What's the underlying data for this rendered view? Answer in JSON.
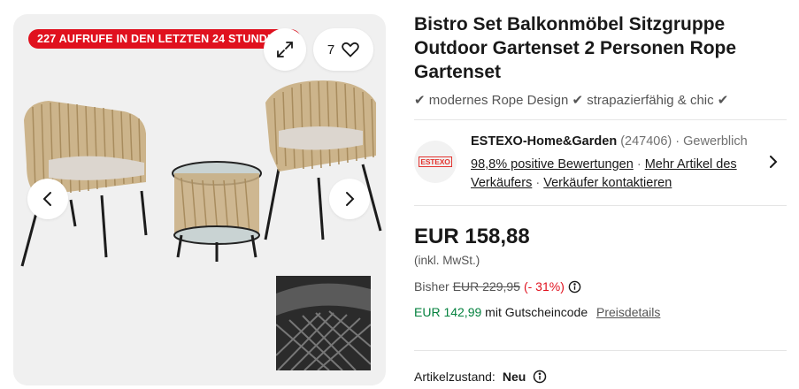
{
  "gallery": {
    "views_badge": "227 AUFRUFE IN DEN LETZTEN 24 STUNDEN",
    "watch_count": "7"
  },
  "product": {
    "title": "Bistro Set Balkonmöbel Sitzgruppe Outdoor Gartenset 2 Personen Rope Gartenset",
    "subtitle": "✔ modernes Rope Design ✔ strapazierfähig & chic ✔"
  },
  "seller": {
    "logo_text": "ESTEXO",
    "name": "ESTEXO-Home&Garden",
    "feedback_count": "(247406)",
    "type": "· Gewerblich",
    "positive": "98,8% positive Bewertungen",
    "more_items": "Mehr Artikel des Verkäufers",
    "contact": "Verkäufer kontaktieren"
  },
  "pricing": {
    "price": "EUR 158,88",
    "tax_note": "(inkl. MwSt.)",
    "was_label": "Bisher",
    "was_price": "EUR 229,95",
    "discount": "(- 31%)",
    "coupon_price": "EUR 142,99",
    "coupon_text": "mit Gutscheincode",
    "price_details": "Preisdetails"
  },
  "condition": {
    "label": "Artikelzustand:",
    "value": "Neu"
  },
  "colors": {
    "badge_red": "#e0111e",
    "coupon_green": "#05823f"
  }
}
